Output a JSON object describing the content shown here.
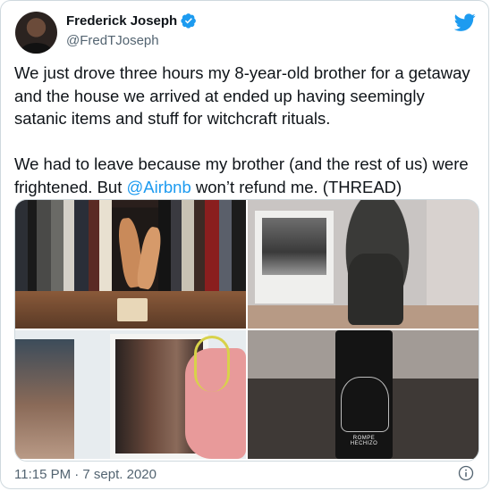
{
  "author": {
    "name": "Frederick Joseph",
    "handle": "@FredTJoseph",
    "verified_icon": "verified-badge-icon",
    "avatar_icon": "profile-avatar"
  },
  "brand": {
    "icon": "twitter-bird-icon",
    "color": "#1d9bf0"
  },
  "tweet": {
    "text_part1": "We just drove three hours my 8-year-old brother for a getaway and the house we arrived at ended up having seemingly satanic items and stuff for witchcraft rituals.\n\nWe had to leave because my brother (and the rest of us) were frightened. But ",
    "mention": "@Airbnb",
    "text_part2": " won’t refund me. (THREAD)"
  },
  "media": [
    {
      "name": "photo-bookshelf-figurine"
    },
    {
      "name": "photo-goat-print-statue"
    },
    {
      "name": "photo-framed-portraits"
    },
    {
      "name": "photo-bottle",
      "label": "ROMPE HECHIZO"
    }
  ],
  "footer": {
    "timestamp": "11:15 PM · 7 sept. 2020",
    "info_icon": "info-icon"
  },
  "colors": {
    "text": "#0f1419",
    "secondary": "#536471",
    "link": "#1d9bf0",
    "border": "#cfd9de"
  }
}
